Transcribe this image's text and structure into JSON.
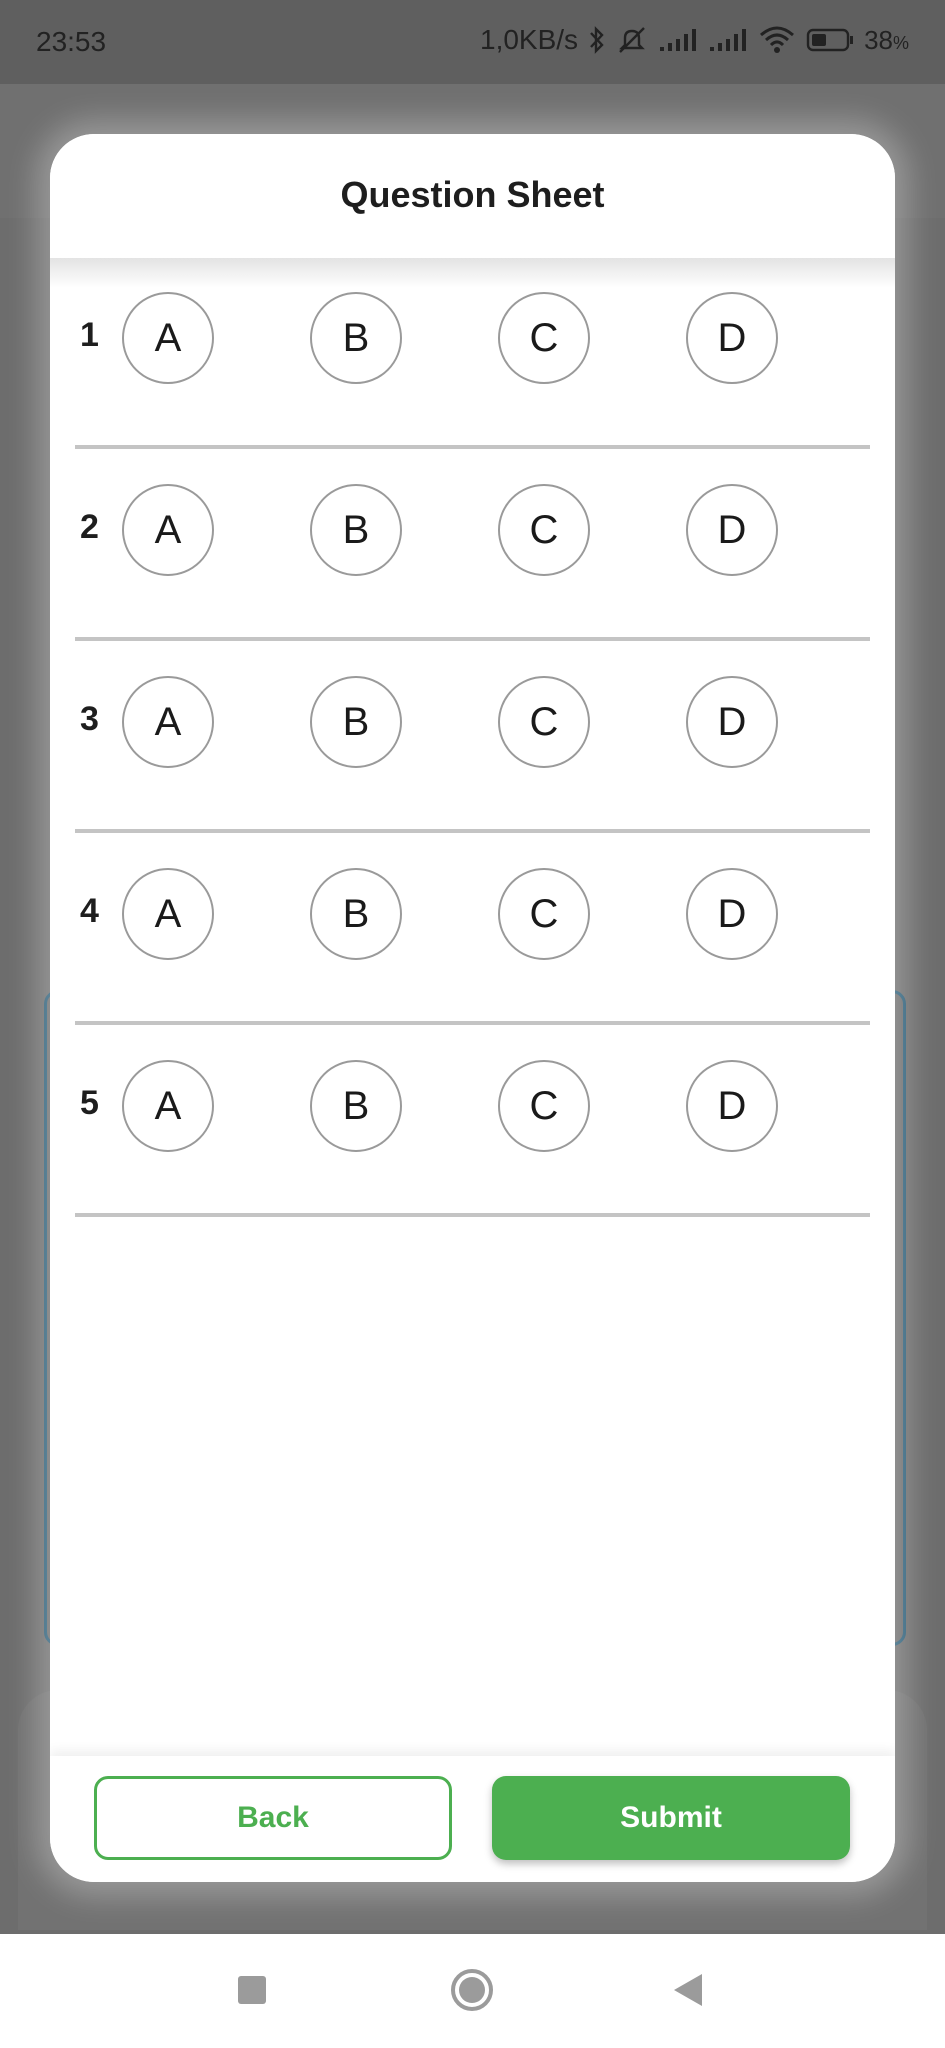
{
  "status_bar": {
    "time": "23:53",
    "network_speed": "1,0KB/s",
    "battery_percent": "38",
    "battery_unit": "%",
    "icons": [
      "bluetooth-icon",
      "mute-icon",
      "signal-icon",
      "signal-icon",
      "wifi-icon",
      "battery-icon"
    ]
  },
  "modal": {
    "title": "Question Sheet",
    "questions": [
      {
        "number": "1",
        "options": [
          "A",
          "B",
          "C",
          "D"
        ]
      },
      {
        "number": "2",
        "options": [
          "A",
          "B",
          "C",
          "D"
        ]
      },
      {
        "number": "3",
        "options": [
          "A",
          "B",
          "C",
          "D"
        ]
      },
      {
        "number": "4",
        "options": [
          "A",
          "B",
          "C",
          "D"
        ]
      },
      {
        "number": "5",
        "options": [
          "A",
          "B",
          "C",
          "D"
        ]
      }
    ],
    "back_label": "Back",
    "submit_label": "Submit"
  },
  "colors": {
    "accent": "#4caf50",
    "divider": "#c4c4c4",
    "option_border": "#9a9a9a"
  },
  "nav_bar": {
    "icons": [
      "recents-icon",
      "home-icon",
      "back-icon"
    ]
  }
}
